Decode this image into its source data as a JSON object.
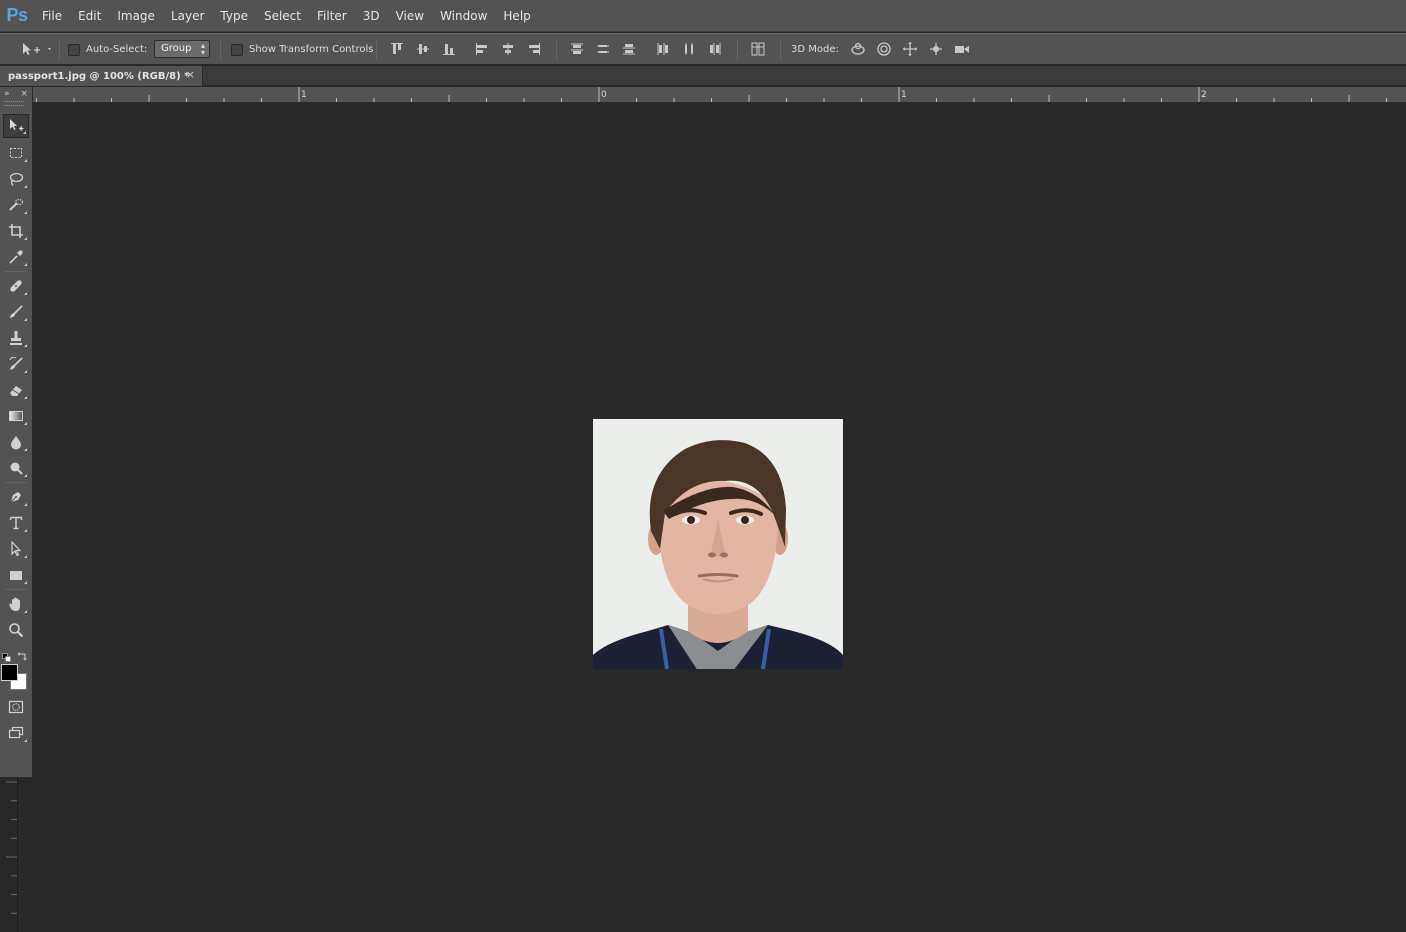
{
  "app": {
    "logo": "Ps"
  },
  "menu": [
    "File",
    "Edit",
    "Image",
    "Layer",
    "Type",
    "Select",
    "Filter",
    "3D",
    "View",
    "Window",
    "Help"
  ],
  "options": {
    "auto_select_label": "Auto-Select:",
    "auto_select_checked": false,
    "group_value": "Group",
    "transform_label": "Show Transform Controls",
    "transform_checked": false,
    "mode_label": "3D Mode:"
  },
  "document": {
    "tab_title": "passport1.jpg @ 100% (RGB/8) *",
    "close_glyph": "×",
    "image_subject": "passport-photo"
  },
  "rulers": {
    "h_labels": [
      "1",
      "0",
      "1",
      "2"
    ]
  },
  "toolbox": {
    "collapse_glyph": "»",
    "close_glyph": "×",
    "foreground_color": "#000000",
    "background_color": "#ffffff"
  },
  "colors": {
    "chrome": "#535353",
    "canvas": "#282828",
    "logo_blue": "#5ba2e0"
  }
}
